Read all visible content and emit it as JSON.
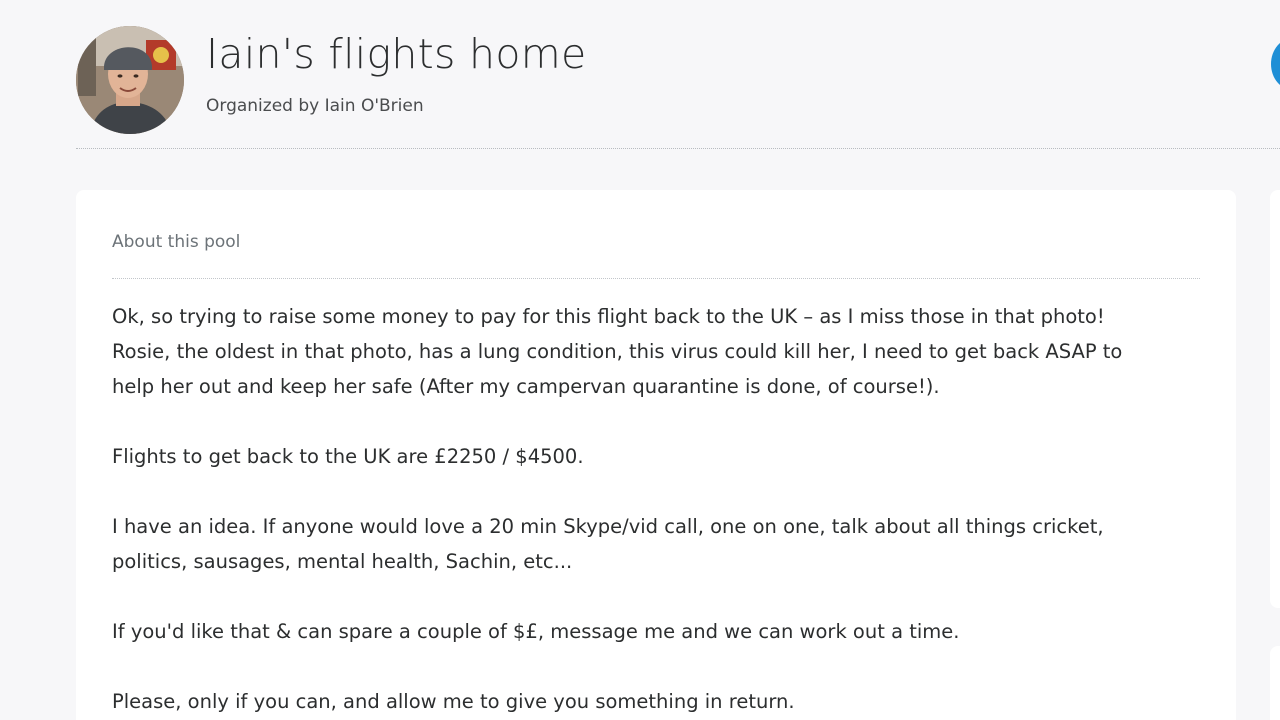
{
  "header": {
    "title": "Iain's flights home",
    "organizer": "Organized by Iain O'Brien"
  },
  "about": {
    "heading": "About this pool",
    "paragraphs": [
      [
        "Ok, so trying to raise some money to pay for this flight back to the UK – as I miss those in that photo!",
        "Rosie, the oldest in that photo, has a lung condition, this virus could kill her, I need to get back ASAP to",
        "help her out and keep her safe (After my campervan quarantine is done, of course!)."
      ],
      [
        "Flights to get back to the UK are £2250 / $4500."
      ],
      [
        "I have an idea. If anyone would love a 20 min Skype/vid call, one on one, talk about all things cricket,",
        "politics, sausages, mental health, Sachin, etc..."
      ],
      [
        "If you'd like that & can spare a couple of $£, message me and we can work out a time."
      ],
      [
        "Please, only if you can, and allow me to give you something in return."
      ]
    ]
  },
  "colors": {
    "background": "#f7f7f9",
    "card": "#ffffff",
    "accent": "#1f8fd6",
    "text": "#2c2e2f",
    "muted": "#6c7378"
  }
}
